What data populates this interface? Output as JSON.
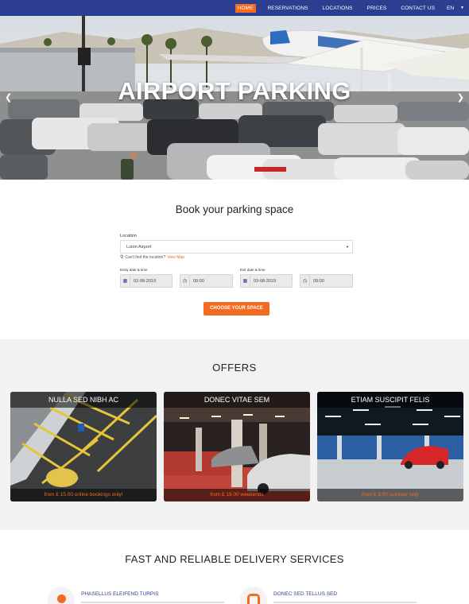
{
  "nav": {
    "items": [
      "HOME",
      "RESERVATIONS",
      "LOCATIONS",
      "PRICES",
      "CONTACT US"
    ],
    "active": "HOME",
    "language": "EN"
  },
  "hero": {
    "title": "AIRPORT PARKING",
    "prev_icon": "chevron-left-icon",
    "next_icon": "chevron-right-icon"
  },
  "booking": {
    "title": "Book your parking space",
    "location_label": "Location",
    "location_value": "Luton Airport",
    "hint_text": "Can't find the location?",
    "hint_link": "View Map",
    "entry_label": "Entry date & time",
    "entry_date": "02-08-2019",
    "entry_time": "09:00",
    "exit_label": "Exit date & time",
    "exit_date": "03-08-2019",
    "exit_time": "09:00",
    "submit_label": "CHOOSE YOUR SPACE"
  },
  "offers": {
    "title": "OFFERS",
    "cards": [
      {
        "title": "NULLA SED NIBH AC",
        "price": "from £ 15.00 online bookings only!"
      },
      {
        "title": "DONEC VITAE SEM",
        "price": "from £ 19.00 weekends"
      },
      {
        "title": "ETIAM SUSCIPIT FELIS",
        "price": "from £ 9.00 summer only"
      }
    ]
  },
  "services": {
    "title": "FAST AND RELIABLE DELIVERY SERVICES",
    "items": [
      {
        "name": "PHASELLUS ELEIFEND TURPIS",
        "icon": "dot-icon"
      },
      {
        "name": "DONEC SED TELLUS SED",
        "icon": "car-seat-icon"
      }
    ]
  },
  "colors": {
    "nav_bg": "#2c3e8f",
    "accent": "#f36b21"
  }
}
